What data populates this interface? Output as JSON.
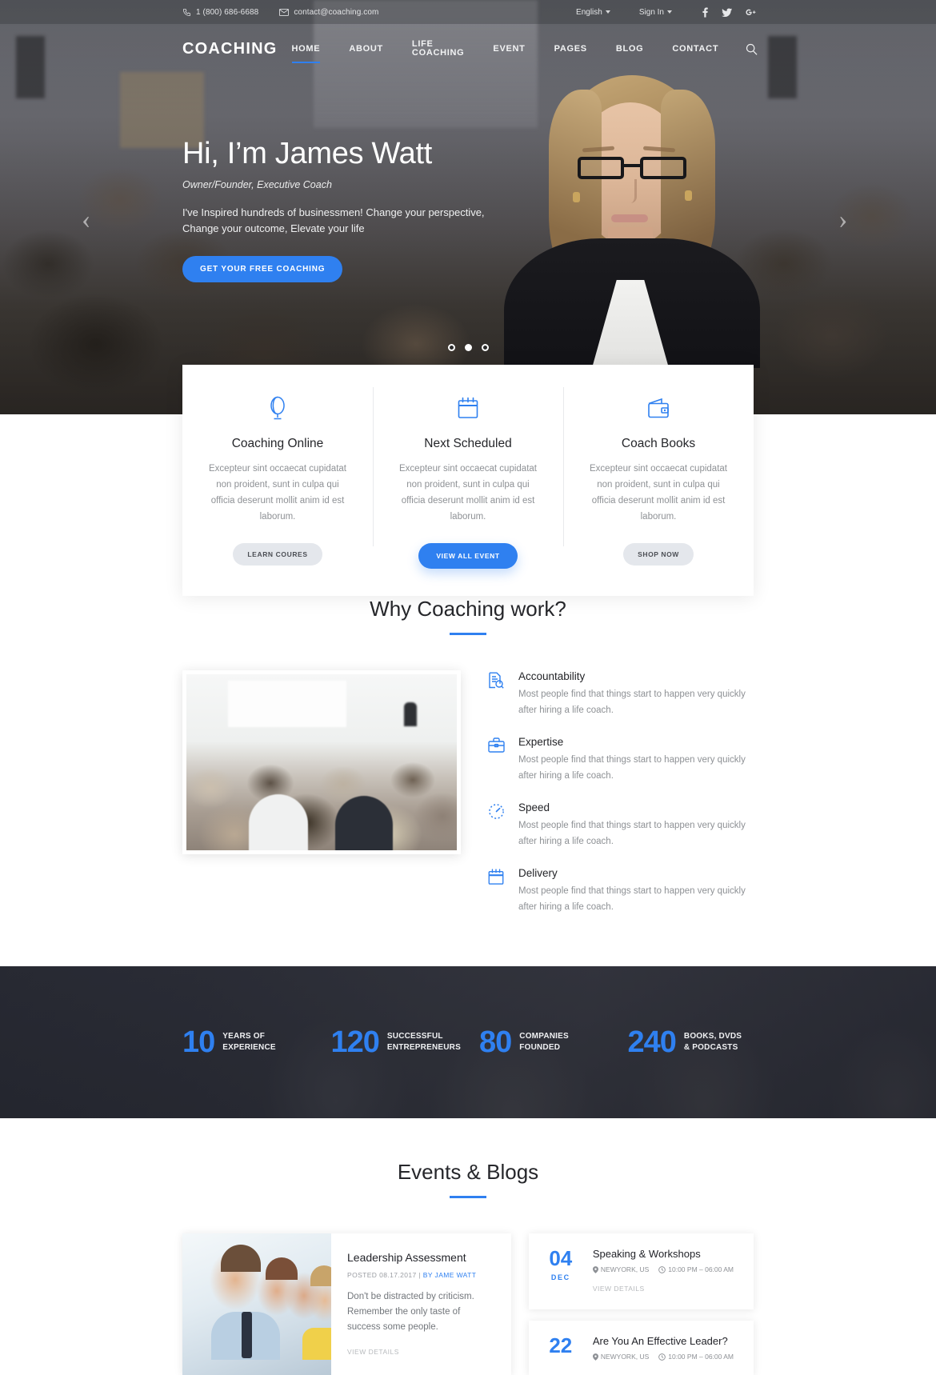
{
  "topbar": {
    "phone": "1 (800) 686-6688",
    "email": "contact@coaching.com",
    "language": "English",
    "signin": "Sign In",
    "social": [
      "f",
      "t",
      "g+"
    ]
  },
  "nav": {
    "brand": "COACHING",
    "items": [
      {
        "label": "HOME",
        "active": true
      },
      {
        "label": "ABOUT",
        "active": false
      },
      {
        "label": "LIFE COACHING",
        "active": false
      },
      {
        "label": "EVENT",
        "active": false
      },
      {
        "label": "PAGES",
        "active": false
      },
      {
        "label": "BLOG",
        "active": false
      },
      {
        "label": "CONTACT",
        "active": false
      }
    ],
    "search_icon": "search-icon"
  },
  "hero": {
    "title": "Hi, I’m James Watt",
    "subtitle": "Owner/Founder, Executive Coach",
    "text": "I've Inspired hundreds of businessmen! Change your perspective, Change your outcome, Elevate your life",
    "cta": "GET YOUR FREE COACHING",
    "slides": 3,
    "active_slide": 2,
    "accent": "#2f80f0"
  },
  "cards": [
    {
      "icon": "globe-microphone-icon",
      "title": "Coaching Online",
      "text": "Excepteur sint occaecat cupidatat non proident, sunt in culpa qui officia deserunt mollit anim id est laborum.",
      "button": "LEARN COURES",
      "primary": false
    },
    {
      "icon": "calendar-icon",
      "title": "Next Scheduled",
      "text": "Excepteur sint occaecat cupidatat non proident, sunt in culpa qui officia deserunt mollit anim id est laborum.",
      "button": "VIEW ALL EVENT",
      "primary": true
    },
    {
      "icon": "wallet-icon",
      "title": "Coach Books",
      "text": "Excepteur sint occaecat cupidatat non proident, sunt in culpa qui officia deserunt mollit anim id est laborum.",
      "button": "SHOP NOW",
      "primary": false
    }
  ],
  "why": {
    "title": "Why Coaching work?",
    "photo_alt": "conference-audience-photo",
    "items": [
      {
        "icon": "document-search-icon",
        "heading": "Accountability",
        "text": "Most people find that things start to happen very quickly after hiring a life coach."
      },
      {
        "icon": "briefcase-icon",
        "heading": "Expertise",
        "text": "Most people find that things start to happen very quickly after hiring a life coach."
      },
      {
        "icon": "speed-dial-icon",
        "heading": "Speed",
        "text": "Most people find that things start to happen very quickly after hiring a life coach."
      },
      {
        "icon": "calendar-icon",
        "heading": "Delivery",
        "text": "Most people find that things start to happen very quickly after hiring a life coach."
      }
    ]
  },
  "stats": [
    {
      "number": "10",
      "label_line1": "YEARS OF",
      "label_line2": "EXPERIENCE"
    },
    {
      "number": "120",
      "label_line1": "SUCCESSFUL",
      "label_line2": "ENTREPRENEURS"
    },
    {
      "number": "80",
      "label_line1": "COMPANIES",
      "label_line2": "FOUNDED"
    },
    {
      "number": "240",
      "label_line1": "BOOKS, DVDS",
      "label_line2": "& PODCASTS"
    }
  ],
  "events_section": {
    "title": "Events & Blogs",
    "blog": {
      "title": "Leadership Assessment",
      "meta_posted": "POSTED 08.17.2017 |",
      "meta_author": "BY JAME WATT",
      "text": "Don't be distracted by criticism. Remember the only taste of success some people.",
      "link": "VIEW DETAILS",
      "photo_alt": "team-meeting-photo"
    },
    "events": [
      {
        "day": "04",
        "month": "DEC",
        "title": "Speaking & Workshops",
        "location": "NEWYORK, US",
        "time": "10:00 PM – 06:00 AM",
        "link": "VIEW DETAILS"
      },
      {
        "day": "22",
        "month": "",
        "title": "Are You An Effective Leader?",
        "location": "NEWYORK, US",
        "time": "10:00 PM – 06:00 AM",
        "link": ""
      }
    ]
  }
}
